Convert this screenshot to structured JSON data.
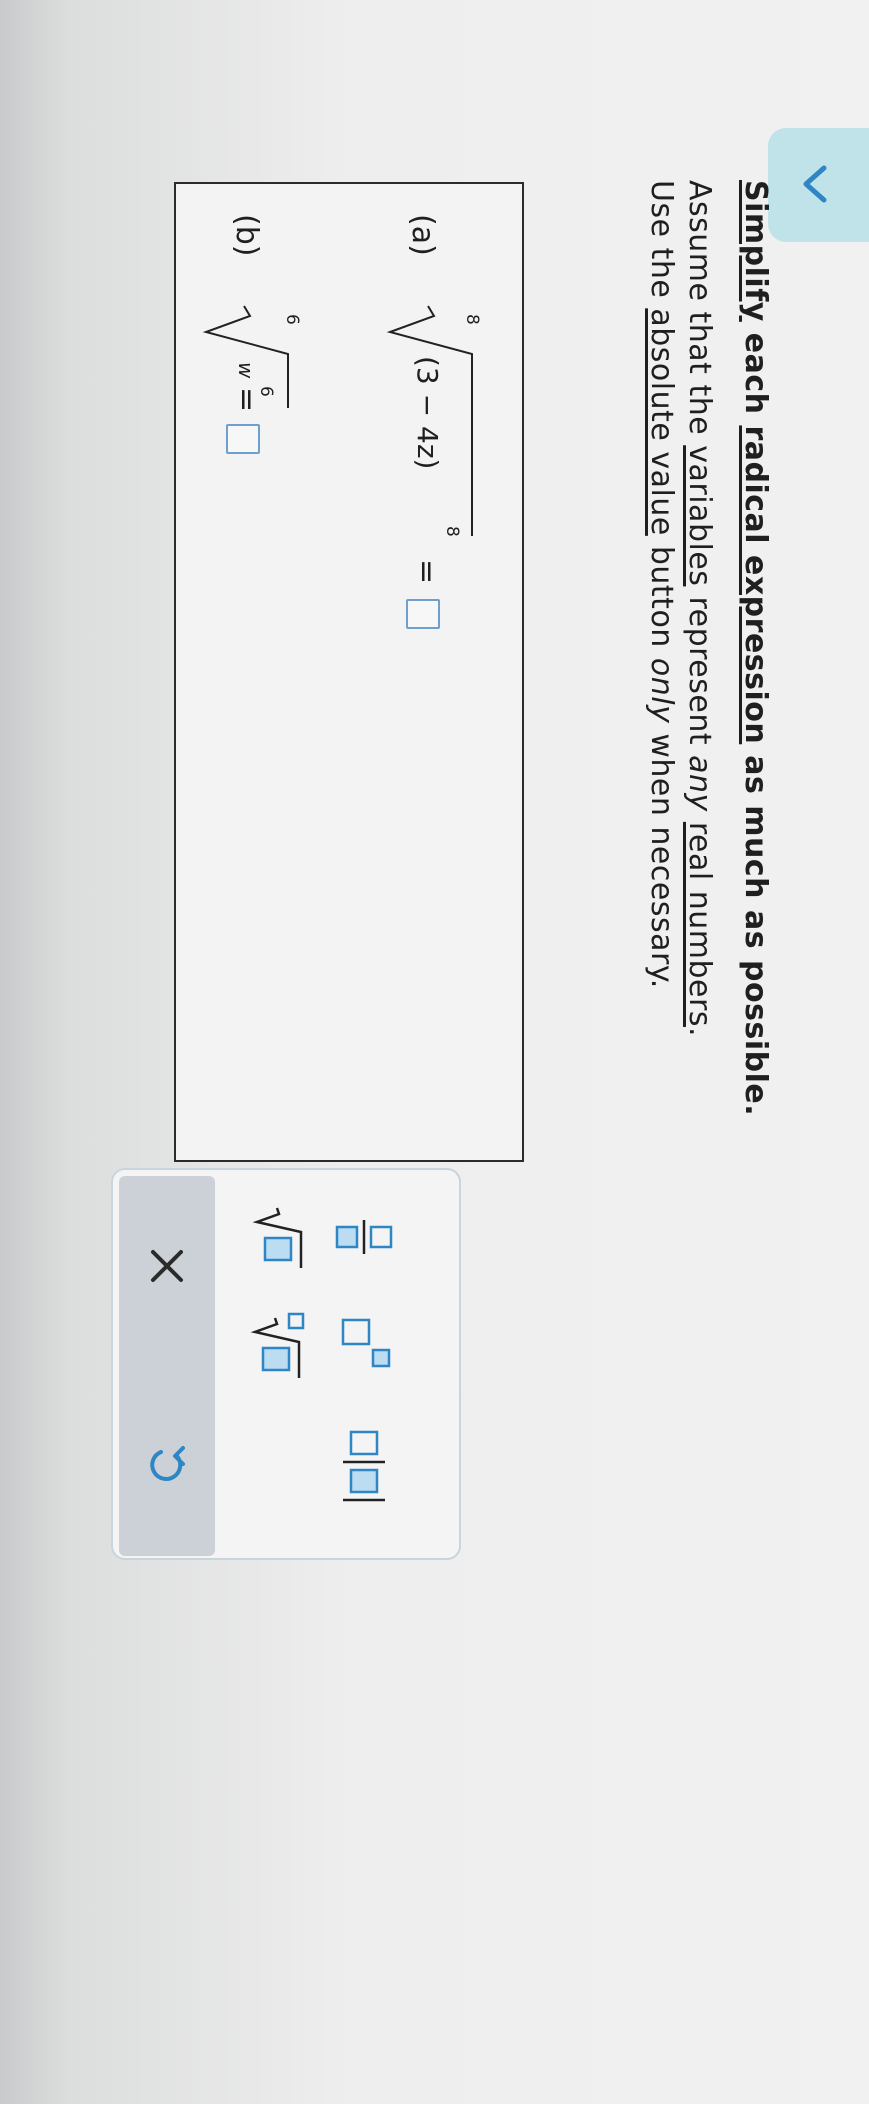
{
  "nav": {
    "collapse_icon": "chevron-left-icon"
  },
  "instructions": {
    "title_link": "Simplify",
    "title_rest": " each ",
    "title_link2": "radical expression",
    "title_end": " as much as possible.",
    "line1_a": "Assume that the ",
    "line1_link1": "variables",
    "line1_b": " represent ",
    "line1_em": "any",
    "line1_c": " ",
    "line1_link2": "real numbers",
    "line1_d": ".",
    "line2_a": "Use the ",
    "line2_link": "absolute value",
    "line2_b": " button ",
    "line2_em": "only",
    "line2_c": " when necessary."
  },
  "problems": [
    {
      "label": "(a)",
      "index": "8",
      "radicand": "(3 − 4z)",
      "exponent": "8",
      "equals": "="
    },
    {
      "label": "(b)",
      "index": "6",
      "radicand": "w",
      "exponent": "6",
      "equals": "="
    }
  ],
  "palette": {
    "buttons": [
      "fraction-icon",
      "exponent-icon",
      "absolute-value-icon",
      "square-root-icon",
      "nth-root-icon"
    ],
    "actions": [
      "clear-icon",
      "undo-icon"
    ]
  },
  "colors": {
    "accent": "#2f86c4",
    "tab": "#bfe3e9",
    "action_bar": "#cbd1d6"
  }
}
